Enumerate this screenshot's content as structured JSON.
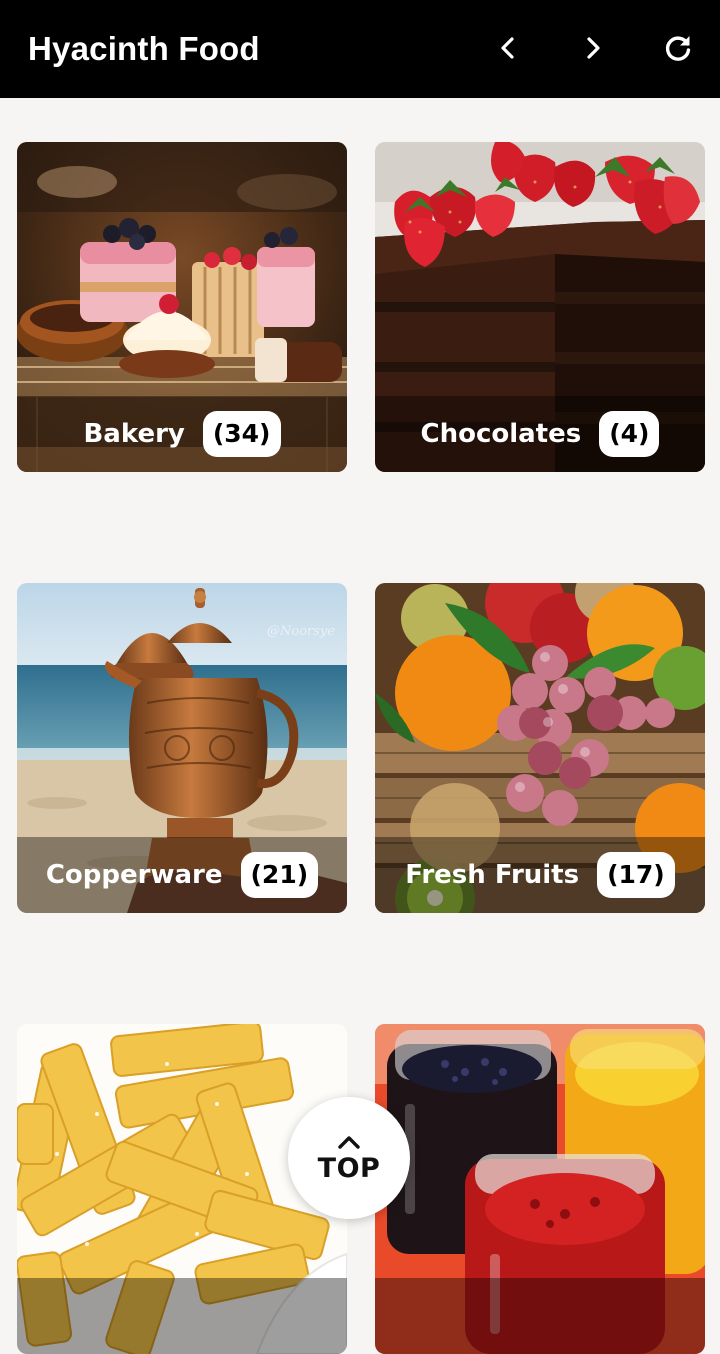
{
  "app": {
    "title": "Hyacinth Food"
  },
  "toolbar": {
    "back_icon": "chevron-left-icon",
    "forward_icon": "chevron-right-icon",
    "refresh_icon": "refresh-icon"
  },
  "categories": [
    {
      "name": "Bakery",
      "count": "(34)",
      "image": "bakery-photo"
    },
    {
      "name": "Chocolates",
      "count": "(4)",
      "image": "chocolate-cake-photo"
    },
    {
      "name": "Copperware",
      "count": "(21)",
      "image": "copper-kettle-photo"
    },
    {
      "name": "Fresh Fruits",
      "count": "(17)",
      "image": "fruit-crate-photo"
    },
    {
      "name": "",
      "count": "",
      "image": "french-fries-photo"
    },
    {
      "name": "",
      "count": "",
      "image": "jam-jars-photo"
    }
  ],
  "scroll_top": {
    "label": "TOP",
    "icon": "chevron-up-icon"
  },
  "colors": {
    "header_bg": "#000000",
    "page_bg": "#f6f5f3",
    "badge_bg": "#ffffff"
  }
}
